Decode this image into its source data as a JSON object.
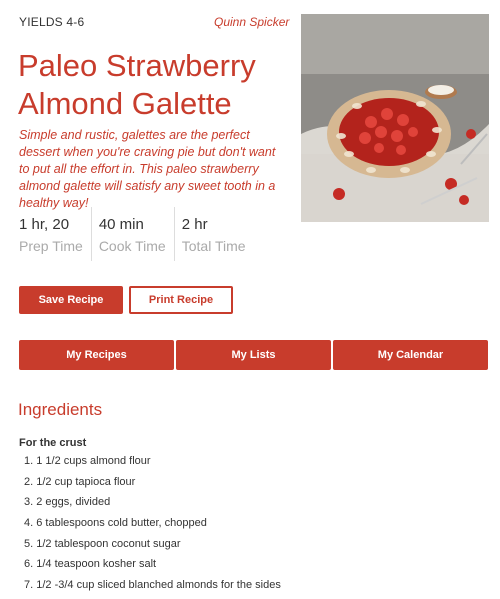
{
  "header": {
    "yields": "YIELDS 4-6",
    "author": "Quinn Spicker"
  },
  "recipe": {
    "title": "Paleo Strawberry Almond Galette",
    "description": "Simple and rustic, galettes are the perfect dessert when you're craving pie but don't want to put all the effort in. This paleo strawberry almond galette will satisfy any sweet tooth in a healthy way!"
  },
  "times": [
    {
      "value": "1 hr, 20",
      "label": "Prep Time"
    },
    {
      "value": "40 min",
      "label": "Cook Time"
    },
    {
      "value": "2 hr",
      "label": "Total Time"
    }
  ],
  "actions": {
    "save_label": "Save Recipe",
    "print_label": "Print Recipe"
  },
  "nav": {
    "items": [
      {
        "label": "My Recipes"
      },
      {
        "label": "My Lists"
      },
      {
        "label": "My Calendar"
      }
    ]
  },
  "ingredients": {
    "title": "Ingredients",
    "section": "For the crust",
    "items": [
      "1. 1 1/2 cups almond flour",
      "2. 1/2 cup tapioca flour",
      "3. 2 eggs, divided",
      "4. 6 tablespoons cold butter, chopped",
      "5. 1/2 tablespoon coconut sugar",
      "6. 1/4 teaspoon kosher salt",
      "7. 1/2 -3/4 cup sliced blanched almonds for the sides"
    ]
  },
  "colors": {
    "accent": "#c83c2c",
    "muted_text": "#aaaaaa"
  }
}
